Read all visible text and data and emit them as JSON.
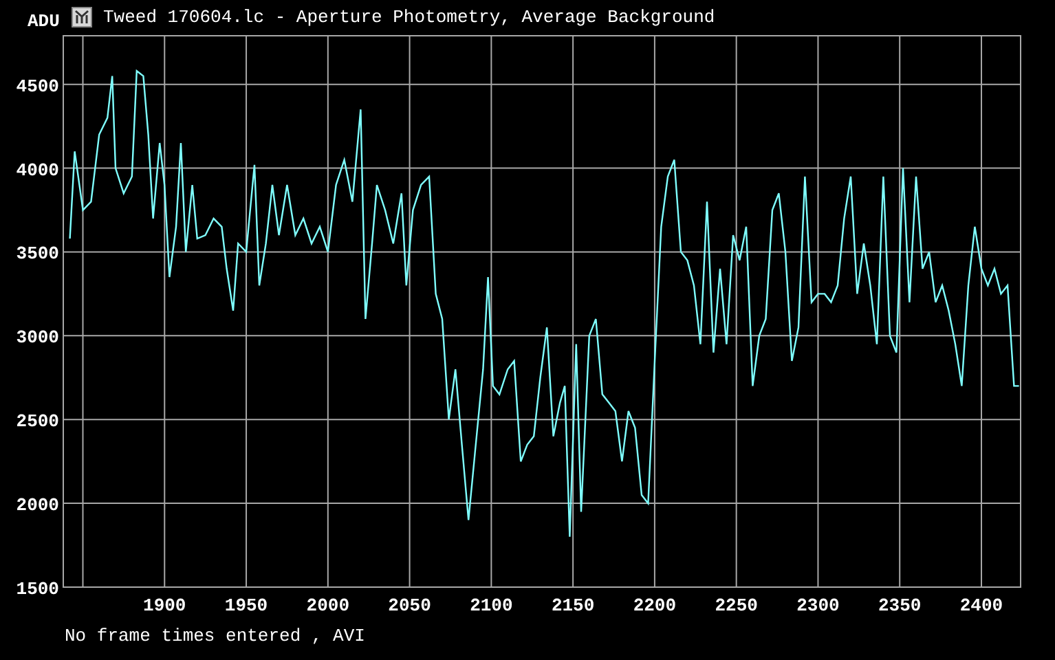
{
  "window": {
    "title": "Tweed 170604.lc - Aperture Photometry, Average Background"
  },
  "chart": {
    "chart_data": {
      "type": "line",
      "grid": true,
      "ylabel": "ADU",
      "xlim": [
        1838,
        2424
      ],
      "ylim": [
        1500,
        4790
      ],
      "xticks": [
        1900,
        1950,
        2000,
        2050,
        2100,
        2150,
        2200,
        2250,
        2300,
        2350,
        2400
      ],
      "yticks": [
        1500,
        2000,
        2500,
        3000,
        3500,
        4000,
        4500
      ],
      "x": [
        1842,
        1845,
        1850,
        1855,
        1860,
        1865,
        1868,
        1870,
        1875,
        1880,
        1883,
        1887,
        1890,
        1893,
        1897,
        1900,
        1903,
        1907,
        1910,
        1913,
        1917,
        1920,
        1925,
        1930,
        1935,
        1938,
        1942,
        1945,
        1950,
        1955,
        1958,
        1962,
        1966,
        1970,
        1975,
        1980,
        1985,
        1990,
        1995,
        2000,
        2005,
        2010,
        2015,
        2020,
        2023,
        2027,
        2030,
        2035,
        2040,
        2045,
        2048,
        2052,
        2057,
        2062,
        2066,
        2070,
        2074,
        2078,
        2082,
        2086,
        2090,
        2095,
        2098,
        2101,
        2105,
        2110,
        2114,
        2118,
        2122,
        2126,
        2130,
        2134,
        2138,
        2142,
        2145,
        2148,
        2152,
        2155,
        2160,
        2164,
        2168,
        2172,
        2176,
        2180,
        2184,
        2188,
        2192,
        2196,
        2200,
        2204,
        2208,
        2212,
        2216,
        2220,
        2224,
        2228,
        2232,
        2236,
        2240,
        2244,
        2248,
        2252,
        2256,
        2260,
        2264,
        2268,
        2272,
        2276,
        2280,
        2284,
        2288,
        2292,
        2296,
        2300,
        2304,
        2308,
        2312,
        2316,
        2320,
        2324,
        2328,
        2332,
        2336,
        2340,
        2344,
        2348,
        2352,
        2356,
        2360,
        2364,
        2368,
        2372,
        2376,
        2380,
        2384,
        2388,
        2392,
        2396,
        2400,
        2404,
        2408,
        2412,
        2416,
        2420,
        2423
      ],
      "series": [
        {
          "color": "#7fffff",
          "values": [
            3580,
            4100,
            3750,
            3800,
            4200,
            4300,
            4550,
            4000,
            3850,
            3950,
            4580,
            4550,
            4200,
            3700,
            4150,
            3900,
            3350,
            3650,
            4150,
            3500,
            3900,
            3580,
            3600,
            3700,
            3650,
            3400,
            3150,
            3550,
            3500,
            4020,
            3300,
            3550,
            3900,
            3600,
            3900,
            3600,
            3700,
            3550,
            3650,
            3500,
            3900,
            4050,
            3800,
            4350,
            3100,
            3550,
            3900,
            3750,
            3550,
            3850,
            3300,
            3750,
            3900,
            3950,
            3250,
            3100,
            2500,
            2800,
            2350,
            1900,
            2300,
            2800,
            3350,
            2700,
            2650,
            2800,
            2850,
            2250,
            2350,
            2400,
            2750,
            3050,
            2400,
            2600,
            2700,
            1800,
            2950,
            1950,
            3000,
            3100,
            2650,
            2600,
            2550,
            2250,
            2550,
            2450,
            2050,
            2000,
            2850,
            3650,
            3950,
            4050,
            3500,
            3450,
            3300,
            2950,
            3800,
            2900,
            3400,
            2950,
            3600,
            3450,
            3650,
            2700,
            3000,
            3100,
            3750,
            3850,
            3500,
            2850,
            3050,
            3950,
            3200,
            3250,
            3250,
            3200,
            3300,
            3700,
            3950,
            3250,
            3550,
            3300,
            2950,
            3950,
            3000,
            2900,
            4000,
            3200,
            3950,
            3400,
            3500,
            3200,
            3300,
            3150,
            2950,
            2700,
            3300,
            3650,
            3400,
            3300,
            3400,
            3250,
            3300,
            2700,
            2700
          ]
        }
      ]
    }
  },
  "footer": "No frame times entered , AVI"
}
